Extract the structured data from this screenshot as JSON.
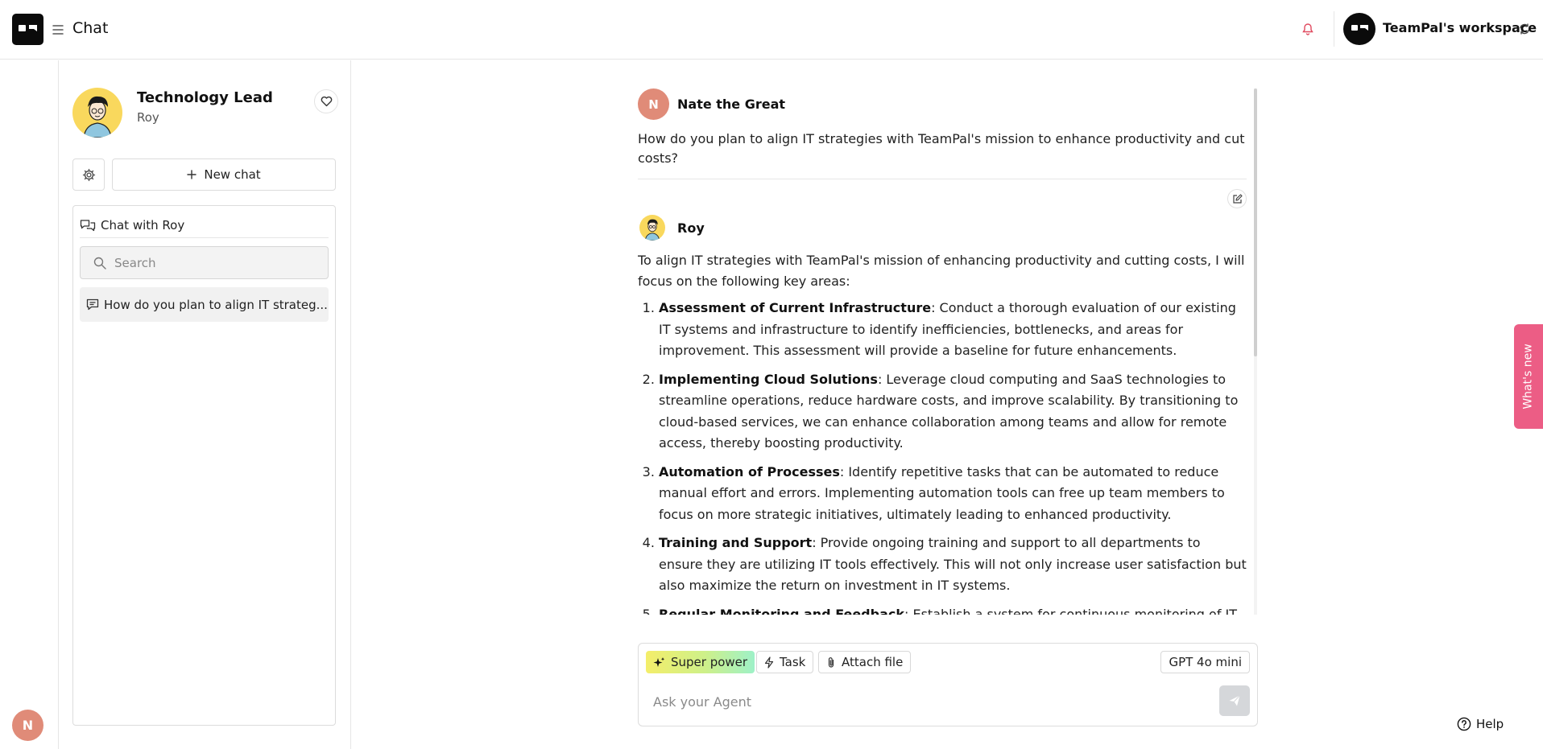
{
  "header": {
    "title": "Chat",
    "workspace_name": "TeamPal's workspace",
    "icons": [
      "app-logo",
      "menu-icon",
      "bell-icon",
      "switch-icon"
    ]
  },
  "rail": {
    "user_initial": "N"
  },
  "agent": {
    "title": "Technology Lead",
    "name": "Roy",
    "new_chat_label": "New chat",
    "chat_list_title": "Chat with Roy",
    "search_placeholder": "Search",
    "chats": [
      {
        "title": "How do you plan to align IT strateg..."
      }
    ]
  },
  "conversation": {
    "user_message": {
      "initial": "N",
      "author": "Nate the Great",
      "text": "How do you plan to align IT strategies with TeamPal's mission to enhance productivity and cut costs?"
    },
    "reply": {
      "author": "Roy",
      "intro": "To align IT strategies with TeamPal's mission of enhancing productivity and cutting costs, I will focus on the following key areas:",
      "items": [
        {
          "title": "Assessment of Current Infrastructure",
          "text": ": Conduct a thorough evaluation of our existing IT systems and infrastructure to identify inefficiencies, bottlenecks, and areas for improvement. This assessment will provide a baseline for future enhancements."
        },
        {
          "title": "Implementing Cloud Solutions",
          "text": ": Leverage cloud computing and SaaS technologies to streamline operations, reduce hardware costs, and improve scalability. By transitioning to cloud-based services, we can enhance collaboration among teams and allow for remote access, thereby boosting productivity."
        },
        {
          "title": "Automation of Processes",
          "text": ": Identify repetitive tasks that can be automated to reduce manual effort and errors. Implementing automation tools can free up team members to focus on more strategic initiatives, ultimately leading to enhanced productivity."
        },
        {
          "title": "Training and Support",
          "text": ": Provide ongoing training and support to all departments to ensure they are utilizing IT tools effectively. This will not only increase user satisfaction but also maximize the return on investment in IT systems."
        },
        {
          "title": "Regular Monitoring and Feedback",
          "text": ": Establish a system for continuous monitoring of IT"
        }
      ]
    }
  },
  "composer": {
    "super_power_label": "Super power",
    "task_label": "Task",
    "attach_label": "Attach file",
    "model": "GPT 4o mini",
    "placeholder": "Ask your Agent"
  },
  "whats_new_label": "What's new",
  "help_label": "Help",
  "colors": {
    "accent_avatar": "#e08b78",
    "agent_avatar_bg": "#f9d85d",
    "whats_new_bg": "#ec5d85",
    "super_power_gradient": [
      "#f4ee6a",
      "#9ef1c8"
    ]
  }
}
